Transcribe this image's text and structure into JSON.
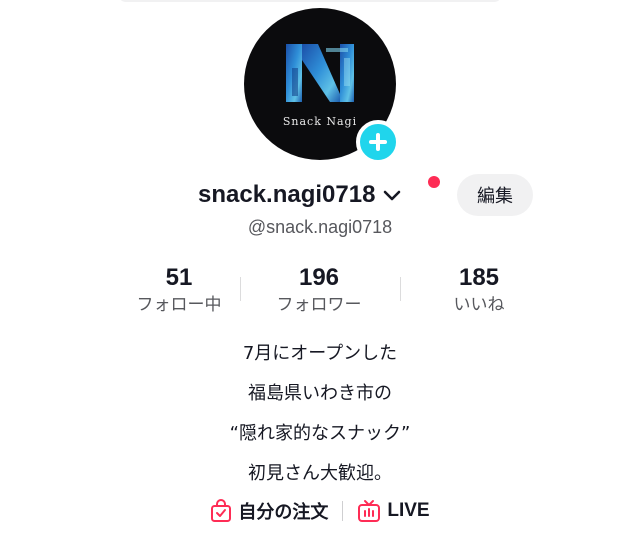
{
  "profile": {
    "avatar_caption": "Snack Nagi",
    "avatar_logo_letter": "N",
    "username": "snack.nagi0718",
    "handle": "@snack.nagi0718",
    "edit_label": "編集",
    "has_notification": true
  },
  "stats": [
    {
      "value": "51",
      "label": "フォロー中"
    },
    {
      "value": "196",
      "label": "フォロワー"
    },
    {
      "value": "185",
      "label": "いいね"
    }
  ],
  "bio": [
    "7月にオープンした",
    "福島県いわき市の",
    "“隠れ家的なスナック”",
    "初見さん大歓迎。"
  ],
  "links": {
    "orders_label": "自分の注文",
    "orders_icon": "shopping-bag-check-icon",
    "live_label": "LIVE",
    "live_icon": "tv-icon"
  },
  "colors": {
    "accent_badge": "#20d5ec",
    "notification": "#fe2c55",
    "link_icon": "#fe2c55",
    "text_primary": "#161823",
    "text_secondary": "#57585d"
  }
}
